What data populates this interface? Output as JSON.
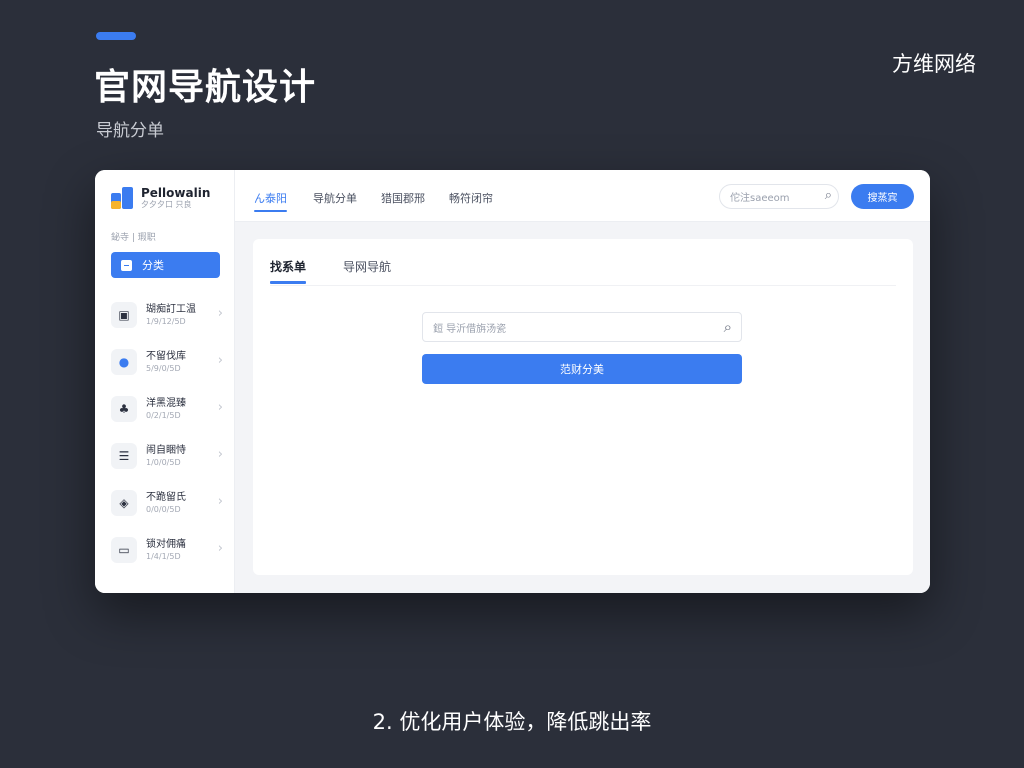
{
  "slide": {
    "title": "官网导航设计",
    "subtitle": "导航分单",
    "brand": "方维网络",
    "caption": "2. 优化用户体验，降低跳出率",
    "accent_color": "#3b7cf0"
  },
  "app": {
    "logo": {
      "name": "Pellowalin",
      "tagline": "夕夕夕口 只良"
    },
    "sidebar": {
      "section_label": "鉍寺 | 瑕职",
      "active_item": {
        "label": "分类",
        "icon": "category-icon"
      },
      "items": [
        {
          "name": "瑚痴訂工温",
          "sub": "1/9/12/5D",
          "icon": "inbox-icon"
        },
        {
          "name": "不留伐库",
          "sub": "5/9/0/5D",
          "icon": "circle-dot-icon"
        },
        {
          "name": "洋黑混臻",
          "sub": "0/2/1/5D",
          "icon": "people-icon"
        },
        {
          "name": "闹自睏恃",
          "sub": "1/0/0/5D",
          "icon": "list-icon"
        },
        {
          "name": "不跪留氏",
          "sub": "0/0/0/5D",
          "icon": "location-icon"
        },
        {
          "name": "锁对佣痛",
          "sub": "1/4/1/5D",
          "icon": "card-icon"
        }
      ]
    },
    "top_nav": {
      "tabs": [
        "ん泰阳",
        "导航分单",
        "猎国郡邢",
        "畅符闭帘"
      ],
      "active_tab": 0,
      "search_placeholder": "佗注saeeom",
      "button_label": "搜蒸宾"
    },
    "card": {
      "tabs": [
        "找系单",
        "导网导航"
      ],
      "active_tab": 0,
      "search_placeholder": "鋀 导沂借旃汤瓷",
      "button_label": "范财分美"
    }
  }
}
